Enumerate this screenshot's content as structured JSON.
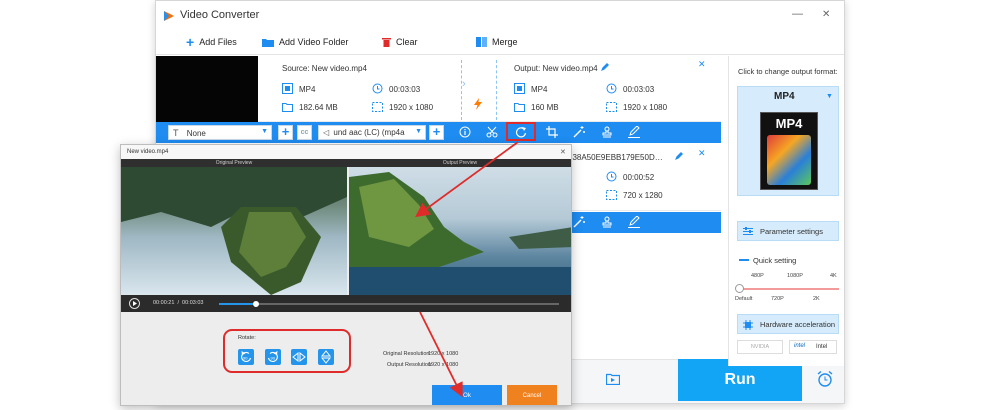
{
  "app": {
    "title": "Video Converter",
    "minimize": "—",
    "close": "✕"
  },
  "toolbar": {
    "add_files": "Add Files",
    "add_folder": "Add Video Folder",
    "clear": "Clear",
    "merge": "Merge"
  },
  "file1": {
    "source": "Source: New video.mp4",
    "src_format": "MP4",
    "src_duration": "00:03:03",
    "src_size": "182.64 MB",
    "src_resolution": "1920 x 1080",
    "output": "Output: New video.mp4",
    "out_format": "MP4",
    "out_duration": "00:03:03",
    "out_size": "160 MB",
    "out_resolution": "1920 x 1080"
  },
  "file2": {
    "output_partial": "538A50E9EBB179E50D…",
    "out_duration": "00:00:52",
    "out_resolution": "720 x 1280"
  },
  "editbar": {
    "subtitle": "None",
    "audio": "und aac (LC) (mp4a"
  },
  "right_panel": {
    "change_format": "Click to change output format:",
    "format": "MP4",
    "format_icon_text": "MP4",
    "param_settings": "Parameter settings",
    "quick_setting": "Quick setting",
    "quality_top": [
      "480P",
      "1080P",
      "4K"
    ],
    "quality_bottom": [
      "Default",
      "720P",
      "2K"
    ],
    "hw_accel": "Hardware acceleration",
    "nvidia": "NVIDIA",
    "intel": "Intel"
  },
  "run": "Run",
  "dialog": {
    "title": "New video.mp4",
    "close": "✕",
    "original_preview": "Original Preview",
    "output_preview": "Output Preview",
    "time": "00:00:21  /  00:03:03",
    "progress": 0.11,
    "rotate_label": "Rotate:",
    "orig_res_label": "Original Resolution:",
    "orig_res": "1920 x 1080",
    "out_res_label": "Output Resolution:",
    "out_res": "1920 x 1080",
    "ok": "Ok",
    "cancel": "Cancel"
  },
  "colors": {
    "accent_blue": "#1e8cf0",
    "run_blue": "#12a4f5",
    "cancel_orange": "#f0811f",
    "highlight_red": "#e02b2b"
  }
}
